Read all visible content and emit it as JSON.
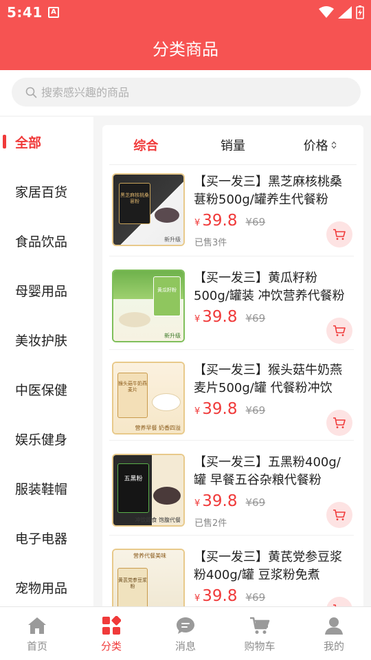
{
  "status": {
    "time": "5:41",
    "notif_letter": "A"
  },
  "header": {
    "title": "分类商品"
  },
  "search": {
    "placeholder": "搜索感兴趣的商品"
  },
  "sidebar": {
    "items": [
      {
        "label": "全部",
        "active": true
      },
      {
        "label": "家居百货"
      },
      {
        "label": "食品饮品"
      },
      {
        "label": "母婴用品"
      },
      {
        "label": "美妆护肤"
      },
      {
        "label": "中医保健"
      },
      {
        "label": "娱乐健身"
      },
      {
        "label": "服装鞋帽"
      },
      {
        "label": "电子电器"
      },
      {
        "label": "宠物用品"
      }
    ]
  },
  "sort": {
    "comprehensive": "综合",
    "sales": "销量",
    "price": "价格"
  },
  "products": [
    {
      "name": "【买一发三】黑芝麻核桃桑葚粉500g/罐养生代餐粉",
      "currency": "¥",
      "price": "39.8",
      "original": "¥69",
      "sold": "已售3件",
      "image_text": "黑芝麻核桃桑葚粉",
      "image_tag": "新升级"
    },
    {
      "name": "【买一发三】黄瓜籽粉500g/罐装 冲饮营养代餐粉",
      "currency": "¥",
      "price": "39.8",
      "original": "¥69",
      "sold": "",
      "image_text": "黄瓜籽粉",
      "image_tag": "新升级"
    },
    {
      "name": "【买一发三】猴头菇牛奶燕麦片500g/罐 代餐粉冲饮",
      "currency": "¥",
      "price": "39.8",
      "original": "¥69",
      "sold": "",
      "image_text": "猴头菇牛奶燕麦片",
      "image_tag": "营养早餐 奶香四溢"
    },
    {
      "name": "【买一发三】五黑粉400g/罐 早餐五谷杂粮代餐粉",
      "currency": "¥",
      "price": "39.8",
      "original": "¥69",
      "sold": "已售2件",
      "image_text": "五黑粉",
      "image_tag": "冲饮即食 饱腹代餐"
    },
    {
      "name": "【买一发三】黄芪党参豆浆粉400g/罐 豆浆粉免煮",
      "currency": "¥",
      "price": "39.8",
      "original": "¥69",
      "sold": "",
      "image_text": "黄芪党参豆浆粉",
      "image_tag": "营养代餐美味"
    }
  ],
  "tabs": [
    {
      "label": "首页",
      "icon": "home-icon"
    },
    {
      "label": "分类",
      "icon": "category-icon",
      "active": true
    },
    {
      "label": "消息",
      "icon": "message-icon"
    },
    {
      "label": "购物车",
      "icon": "cart-icon"
    },
    {
      "label": "我的",
      "icon": "user-icon"
    }
  ],
  "colors": {
    "brand": "#f65352",
    "accent": "#f03a3a",
    "muted": "#8c8c8c"
  }
}
